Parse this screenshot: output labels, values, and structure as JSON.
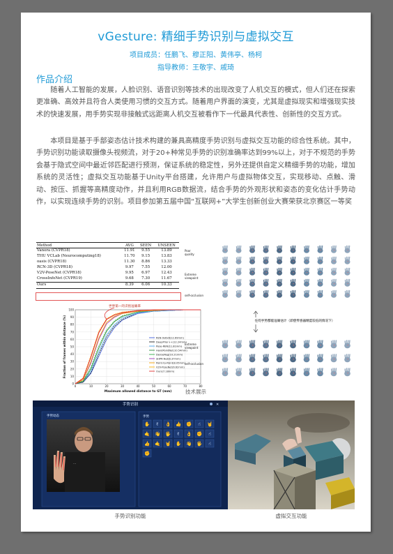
{
  "header": {
    "title": "vGesture: 精细手势识别与虚拟交互",
    "members": "项目成员：任鹏飞、穆正阳、黄伟亭、杨柯",
    "advisor": "指导教师：王敬宇、戚琦"
  },
  "intro": {
    "heading": "作品介绍",
    "para1": "随着人工智能的发展，人脸识别、语音识别等技术的出现改变了人机交互的模式，但人们还在探索更准确、高效并且符合人类使用习惯的交互方式。随着用户界面的演变，尤其是虚拟现实和增强现实技术的快速发展，用手势实现非接触式远距离人机交互被看作下一代最具代表性、创新性的交互方式。",
    "para2": "本项目是基于手部姿态估计技术构建的兼具高精度手势识别与虚拟交互功能的综合性系统。其中，手势识别功能读取摄像头视频流，对于20+种常见手势的识别准确率达到99%以上，对于不规范的手势会基于隐式空间中最近邻匹配进行预测，保证系统的稳定性，另外还提供自定义精细手势的功能，增加系统的灵活性；虚拟交互功能基于Unity平台搭建，允许用户与虚拟物体交互，实现移动、点触、滑动、按压、抓握等高精度动作，并且利用RGB数据流，结合手势的外观形状和姿态的变化估计手势动作，以实现连续手势的识别。项目参加第五届中国“互联网+”大学生创新创业大赛荣获北京赛区一等奖"
  },
  "table": {
    "headers": [
      "Method",
      "AVG",
      "SEEN",
      "UNSEEN"
    ],
    "rows": [
      [
        "Vanora (CVPR18)",
        "11.91",
        "9.55",
        "13.89"
      ],
      [
        "THU VCLab (Neurocomputing18)",
        "11.70",
        "9.15",
        "13.83"
      ],
      [
        "oasis (CVPR18)",
        "11.30",
        "8.86",
        "13.33"
      ],
      [
        "RCN-3D (CVPR18)",
        "9.97",
        "7.55",
        "12.00"
      ],
      [
        "V2V-PoseNet (CVPR18)",
        "9.95",
        "6.97",
        "12.43"
      ],
      [
        "CrossInfoNet (CVPR19)",
        "9.68",
        "7.30",
        "11.67"
      ]
    ],
    "ours": [
      "Ours",
      "8.39",
      "6.06",
      "10.33"
    ]
  },
  "chart_data": {
    "type": "line",
    "annotation": "世界第一的识别准确率",
    "xlabel": "Maximum allowed distance to GT (mm)",
    "ylabel": "Fraction of frames within distance (%)",
    "xlim": [
      0,
      80
    ],
    "ylim": [
      0,
      100
    ],
    "x_ticks": [
      0,
      10,
      20,
      30,
      40,
      50,
      60,
      70,
      80
    ],
    "y_ticks": [
      0,
      10,
      20,
      30,
      40,
      50,
      60,
      70,
      80,
      90,
      100
    ],
    "x": [
      0,
      5,
      10,
      15,
      20,
      25,
      30,
      40,
      50,
      60,
      70,
      80
    ],
    "series": [
      {
        "name": "REN-9x6x6(12.69mm)",
        "color": "#3b5bdb",
        "values": [
          0,
          2,
          14,
          37,
          60,
          76,
          86,
          95,
          98,
          99,
          100,
          100
        ]
      },
      {
        "name": "DeepPrior++(12.24mm)",
        "color": "#222222",
        "values": [
          0,
          2,
          15,
          40,
          63,
          78,
          87,
          96,
          98,
          99,
          100,
          100
        ]
      },
      {
        "name": "Pose-REN(11.81mm)",
        "color": "#4dabf7",
        "values": [
          0,
          3,
          17,
          43,
          66,
          80,
          89,
          96,
          98,
          99,
          100,
          100
        ]
      },
      {
        "name": "HandPointNet(10.54mm)",
        "color": "#2b8a3e",
        "values": [
          0,
          3,
          20,
          48,
          71,
          84,
          91,
          97,
          99,
          100,
          100,
          100
        ]
      },
      {
        "name": "DenseReg(10.21mm)",
        "color": "#37b24d",
        "values": [
          0,
          4,
          22,
          51,
          73,
          85,
          92,
          97,
          99,
          100,
          100,
          100
        ]
      },
      {
        "name": "SHPR-Net(8.37mm)",
        "color": "#9c36b5",
        "values": [
          0,
          5,
          28,
          60,
          81,
          90,
          95,
          98,
          99,
          100,
          100,
          100
        ]
      },
      {
        "name": "Point-to-Point(8.05mm)",
        "color": "#f59f00",
        "values": [
          0,
          5,
          30,
          62,
          83,
          91,
          95,
          98,
          99,
          100,
          100,
          100
        ]
      },
      {
        "name": "V2V-PoseNet(6.62mm)",
        "color": "#fab005",
        "values": [
          0,
          8,
          38,
          71,
          88,
          94,
          97,
          99,
          100,
          100,
          100,
          100
        ]
      },
      {
        "name": "Ours(7.18mm)",
        "color": "#e03131",
        "values": [
          0,
          7,
          36,
          69,
          87,
          93,
          96,
          99,
          100,
          100,
          100,
          100
        ]
      }
    ]
  },
  "gestures": {
    "label_poor_quality": "Poor quality",
    "label_extreme": "Extreme viewpoint",
    "label_self_occ": "self-occlusion",
    "label_extreme2": "Extreme viewpoint",
    "label_self_occ2": "self-occlusion",
    "middle_note": "任何手势都能准确估计（即使传感器精度较低的情况下）",
    "caption": "技术展示"
  },
  "app_left": {
    "window_title": "手势识别",
    "panel_label": "手势动态",
    "grid_title": "手势",
    "icons": [
      "✋",
      "✌",
      "👌",
      "👍",
      "✊",
      "☝",
      "🤘",
      "🤙",
      "👋",
      "🖐",
      "✌",
      "👌",
      "✊",
      "☝",
      "👍",
      "🤙",
      "🤘",
      "✋",
      "👋",
      "🖐",
      "☝",
      "✊"
    ],
    "caption": "手势识别功能"
  },
  "app_right": {
    "caption": "虚拟交互功能"
  },
  "colors": {
    "accent": "#1f9ad6",
    "text": "#555555",
    "highlight": "#e25555",
    "app_bg": "#10264d"
  }
}
